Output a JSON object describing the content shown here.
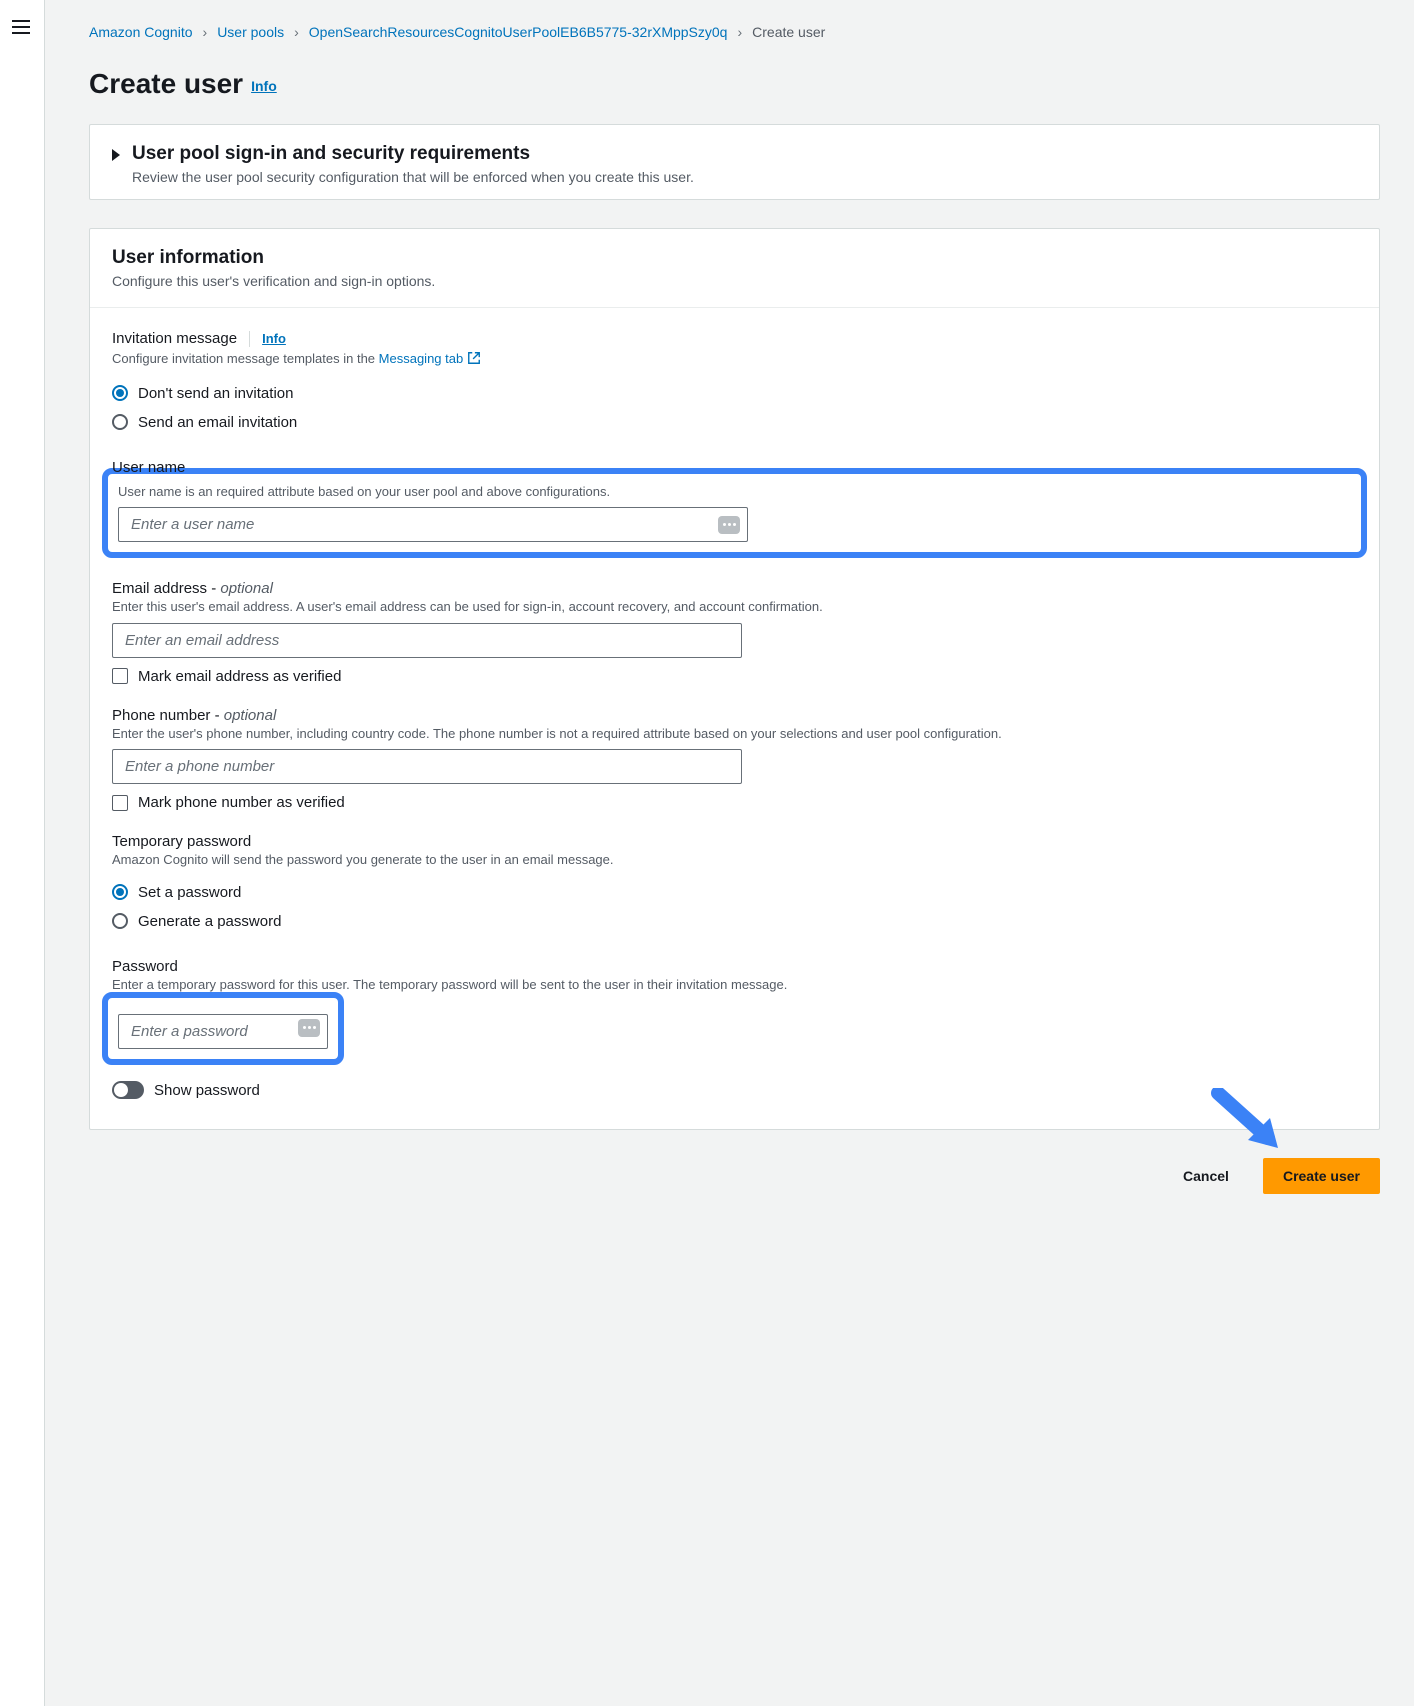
{
  "breadcrumb": {
    "root": "Amazon Cognito",
    "pools": "User pools",
    "pool_name": "OpenSearchResourcesCognitoUserPoolEB6B5775-32rXMppSzy0q",
    "current": "Create user"
  },
  "page": {
    "title": "Create user",
    "info": "Info"
  },
  "expander": {
    "title": "User pool sign-in and security requirements",
    "sub": "Review the user pool security configuration that will be enforced when you create this user."
  },
  "section": {
    "title": "User information",
    "sub": "Configure this user's verification and sign-in options."
  },
  "invitation": {
    "label": "Invitation message",
    "info": "Info",
    "desc_prefix": "Configure invitation message templates in the ",
    "link": "Messaging tab",
    "opt_dont_send": "Don't send an invitation",
    "opt_email": "Send an email invitation"
  },
  "username": {
    "label": "User name",
    "help": "User name is an required attribute based on your user pool and above configurations.",
    "placeholder": "Enter a user name"
  },
  "email": {
    "label_prefix": "Email address - ",
    "optional": "optional",
    "help": "Enter this user's email address. A user's email address can be used for sign-in, account recovery, and account confirmation.",
    "placeholder": "Enter an email address",
    "verify": "Mark email address as verified"
  },
  "phone": {
    "label_prefix": "Phone number - ",
    "optional": "optional",
    "help": "Enter the user's phone number, including country code. The phone number is not a required attribute based on your selections and user pool configuration.",
    "placeholder": "Enter a phone number",
    "verify": "Mark phone number as verified"
  },
  "temp_pw": {
    "label": "Temporary password",
    "help": "Amazon Cognito will send the password you generate to the user in an email message.",
    "opt_set": "Set a password",
    "opt_gen": "Generate a password"
  },
  "password": {
    "label": "Password",
    "help": "Enter a temporary password for this user. The temporary password will be sent to the user in their invitation message.",
    "placeholder": "Enter a password",
    "show": "Show password"
  },
  "footer": {
    "cancel": "Cancel",
    "submit": "Create user"
  }
}
